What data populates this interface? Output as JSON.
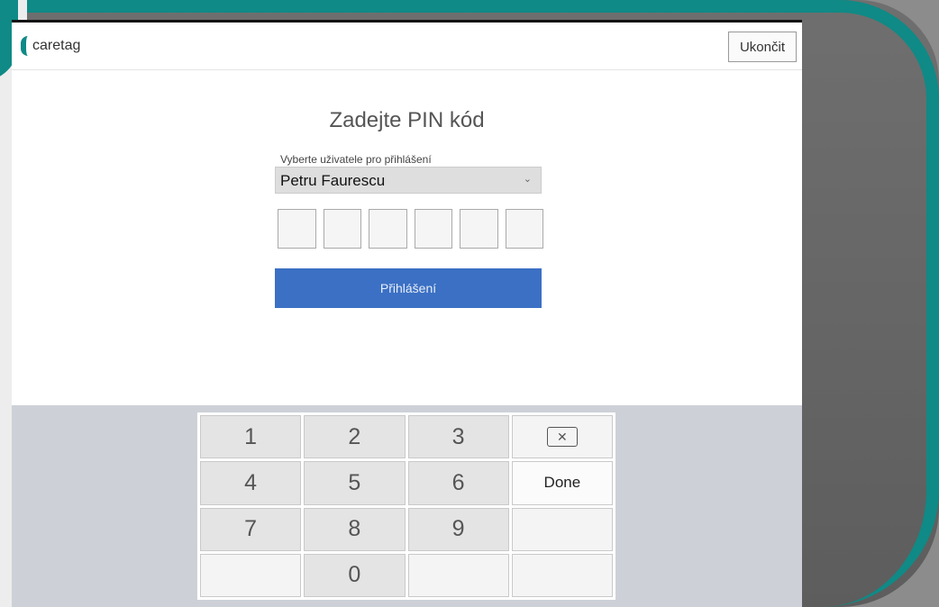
{
  "app": {
    "brand": "caretag",
    "exit_label": "Ukončit"
  },
  "login": {
    "title": "Zadejte PIN kód",
    "select_label": "Vyberte uživatele pro přihlášení",
    "selected_user": "Petru Faurescu",
    "pin_length": 6,
    "submit_label": "Přihlášení"
  },
  "keypad": {
    "keys": [
      "1",
      "2",
      "3",
      "backspace",
      "4",
      "5",
      "6",
      "Done",
      "7",
      "8",
      "9",
      "",
      "",
      "0",
      "",
      ""
    ],
    "done_label": "Done"
  },
  "colors": {
    "accent": "#3b70c4",
    "brand": "#0f8a86"
  }
}
